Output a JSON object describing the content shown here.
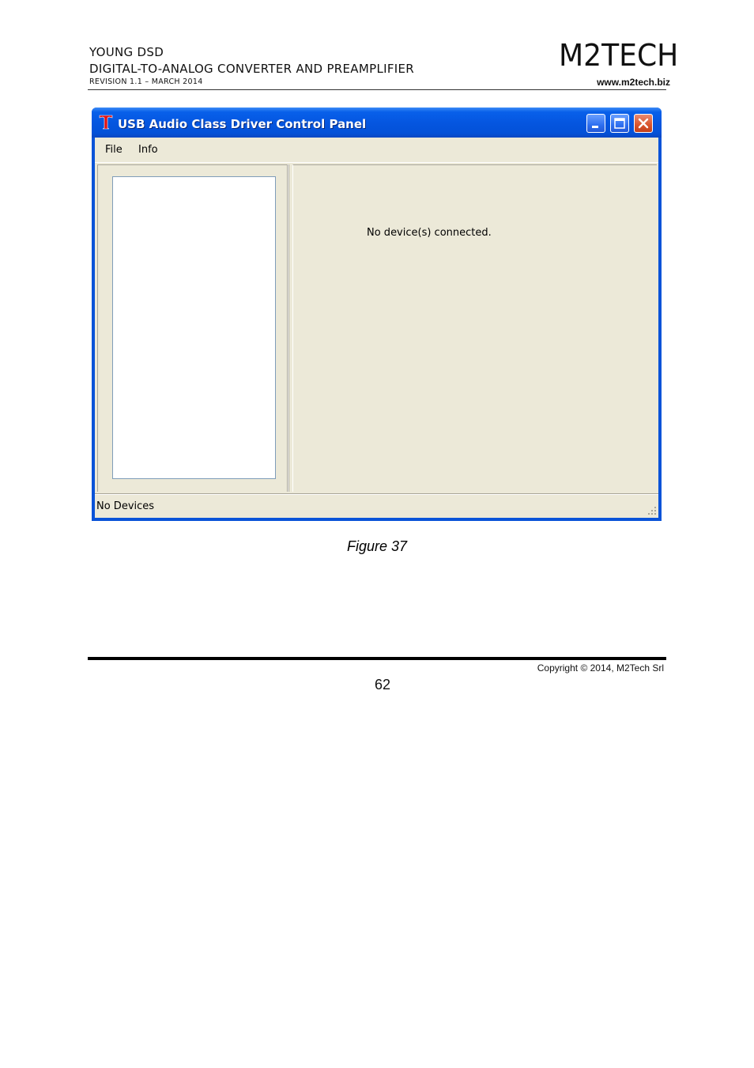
{
  "header": {
    "product": "YOUNG DSD",
    "subtitle": "DIGITAL-TO-ANALOG CONVERTER AND PREAMPLIFIER",
    "revision": "REVISION 1.1 – MARCH 2014",
    "logo": "M2TECH",
    "website": "www.m2tech.biz"
  },
  "window": {
    "title": "USB Audio Class Driver Control Panel",
    "icon": "t-logo-icon",
    "menu": [
      "File",
      "Info"
    ],
    "message": "No device(s) connected.",
    "status": "No Devices",
    "colors": {
      "titlebar": "#0556e0",
      "client": "#ece9d8",
      "close": "#d8542c"
    }
  },
  "caption": "Figure 37",
  "footer": {
    "copyright": "Copyright © 2014, M2Tech Srl",
    "page_number": "62"
  }
}
